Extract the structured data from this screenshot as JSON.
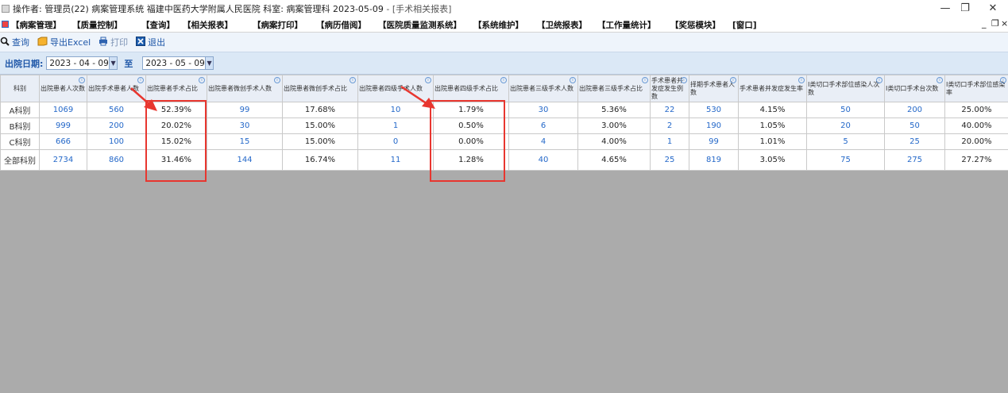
{
  "window": {
    "title": "操作者: 管理员(22) 病案管理系统  福建中医药大学附属人民医院  科室: 病案管理科 2023-05-09",
    "subtitle": "- [手术相关报表]",
    "minimize_glyph": "—",
    "restore_glyph": "❐",
    "close_glyph": "✕"
  },
  "menubar": {
    "items": [
      "【病案管理】",
      "【质量控制】",
      "【查询】",
      "【相关报表】",
      "【病案打印】",
      "【病历借阅】",
      "【医院质量监测系统】",
      "【系统维护】",
      "【卫统报表】",
      "【工作量统计】",
      "【奖惩模块】",
      "[窗口]"
    ],
    "mdi_minimize": "_",
    "mdi_restore": "❐",
    "mdi_close": "×"
  },
  "toolbar": {
    "query_label": "查询",
    "export_label": "导出Excel",
    "print_label": "打印",
    "exit_label": "退出",
    "icons": [
      "search-icon",
      "excel-icon",
      "printer-icon",
      "exit-icon"
    ]
  },
  "filter": {
    "label": "出院日期:",
    "start_date": "2023 - 04 - 09",
    "to_label": "至",
    "end_date": "2023 - 05 - 09"
  },
  "table": {
    "columns": [
      "科别",
      "出院患者人次数",
      "出院手术患者人数",
      "出院患者手术占比",
      "出院患者微创手术人数",
      "出院患者微创手术占比",
      "出院患者四级手术人数",
      "出院患者四级手术占比",
      "出院患者三级手术人数",
      "出院患者三级手术占比",
      "手术患者并发症发生例数",
      "择期手术患者人数",
      "手术患者并发症发生率",
      "I类切口手术部位感染人次数",
      "I类切口手术台次数",
      "I类切口手术部位感染率"
    ],
    "rows": [
      [
        "A科别",
        "1069",
        "560",
        "52.39%",
        "99",
        "17.68%",
        "10",
        "1.79%",
        "30",
        "5.36%",
        "22",
        "530",
        "4.15%",
        "50",
        "200",
        "25.00%"
      ],
      [
        "B科别",
        "999",
        "200",
        "20.02%",
        "30",
        "15.00%",
        "1",
        "0.50%",
        "6",
        "3.00%",
        "2",
        "190",
        "1.05%",
        "20",
        "50",
        "40.00%"
      ],
      [
        "C科别",
        "666",
        "100",
        "15.02%",
        "15",
        "15.00%",
        "0",
        "0.00%",
        "4",
        "4.00%",
        "1",
        "99",
        "1.01%",
        "5",
        "25",
        "20.00%"
      ],
      [
        "全部科别",
        "2734",
        "860",
        "31.46%",
        "144",
        "16.74%",
        "11",
        "1.28%",
        "40",
        "4.65%",
        "25",
        "819",
        "3.05%",
        "75",
        "275",
        "27.27%"
      ]
    ],
    "link_columns": [
      1,
      2,
      4,
      6,
      8,
      10,
      11,
      13,
      14
    ],
    "colors": {
      "link": "#2468c9",
      "header_bg": "#e9eef6",
      "highlight": "#e8362f",
      "empty_area": "#ababab"
    }
  }
}
